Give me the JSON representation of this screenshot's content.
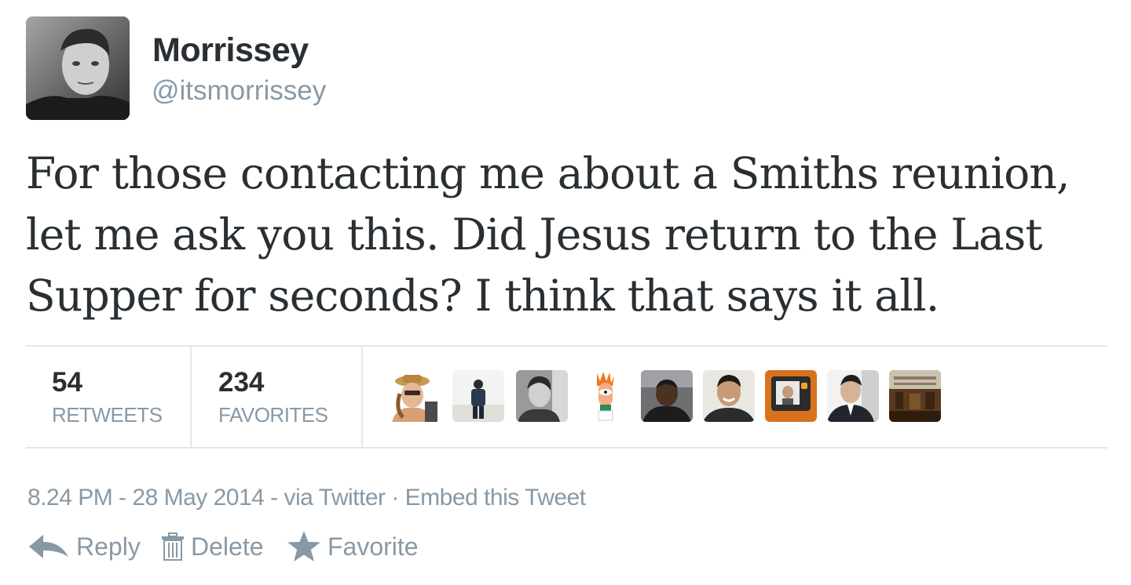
{
  "user": {
    "full_name": "Morrissey",
    "username": "@itsmorrissey",
    "avatar_icon": "profile-photo"
  },
  "tweet": {
    "text": "For those contacting me about a Smiths reunion, let me ask you this. Did Jesus return to the Last Supper for seconds? I think that says it all."
  },
  "stats": {
    "retweets_count": "54",
    "retweets_label": "RETWEETS",
    "favorites_count": "234",
    "favorites_label": "FAVORITES"
  },
  "favoriter_avatars": [
    "avatar-woman-hat",
    "avatar-man-standing",
    "avatar-man-portrait",
    "avatar-muppet",
    "avatar-man-dark",
    "avatar-man-smiling",
    "avatar-orange-frame",
    "avatar-man-suit",
    "avatar-room"
  ],
  "meta": {
    "time": "8.24 PM - 28 May 2014",
    "via": " - via Twitter",
    "sep": " · ",
    "embed": "Embed this Tweet"
  },
  "actions": {
    "reply": "Reply",
    "delete": "Delete",
    "favorite": "Favorite"
  },
  "colors": {
    "text": "#292f33",
    "muted": "#8899a6",
    "divider": "#e1e8ed"
  }
}
